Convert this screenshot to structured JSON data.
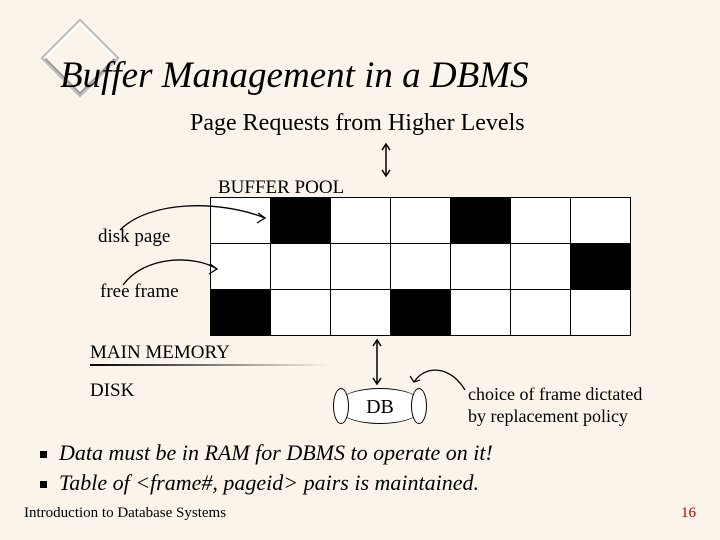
{
  "title": "Buffer Management in a DBMS",
  "subtitle": "Page Requests from Higher Levels",
  "labels": {
    "buffer_pool": "BUFFER POOL",
    "disk_page": "disk page",
    "free_frame": "free frame",
    "main_memory": "MAIN MEMORY",
    "disk": "DISK",
    "db": "DB"
  },
  "replacement_note": {
    "line1": "choice of frame dictated",
    "line2": "by replacement policy"
  },
  "bullets": [
    "Data must be in RAM for DBMS to operate on it!",
    "Table of <frame#, pageid> pairs is maintained."
  ],
  "footer": {
    "left": "Introduction to Database Systems",
    "right": "16"
  },
  "grid": {
    "rows": 3,
    "cols": 7,
    "filled_cells": [
      [
        0,
        1
      ],
      [
        0,
        4
      ],
      [
        1,
        6
      ],
      [
        2,
        0
      ],
      [
        2,
        3
      ]
    ]
  }
}
